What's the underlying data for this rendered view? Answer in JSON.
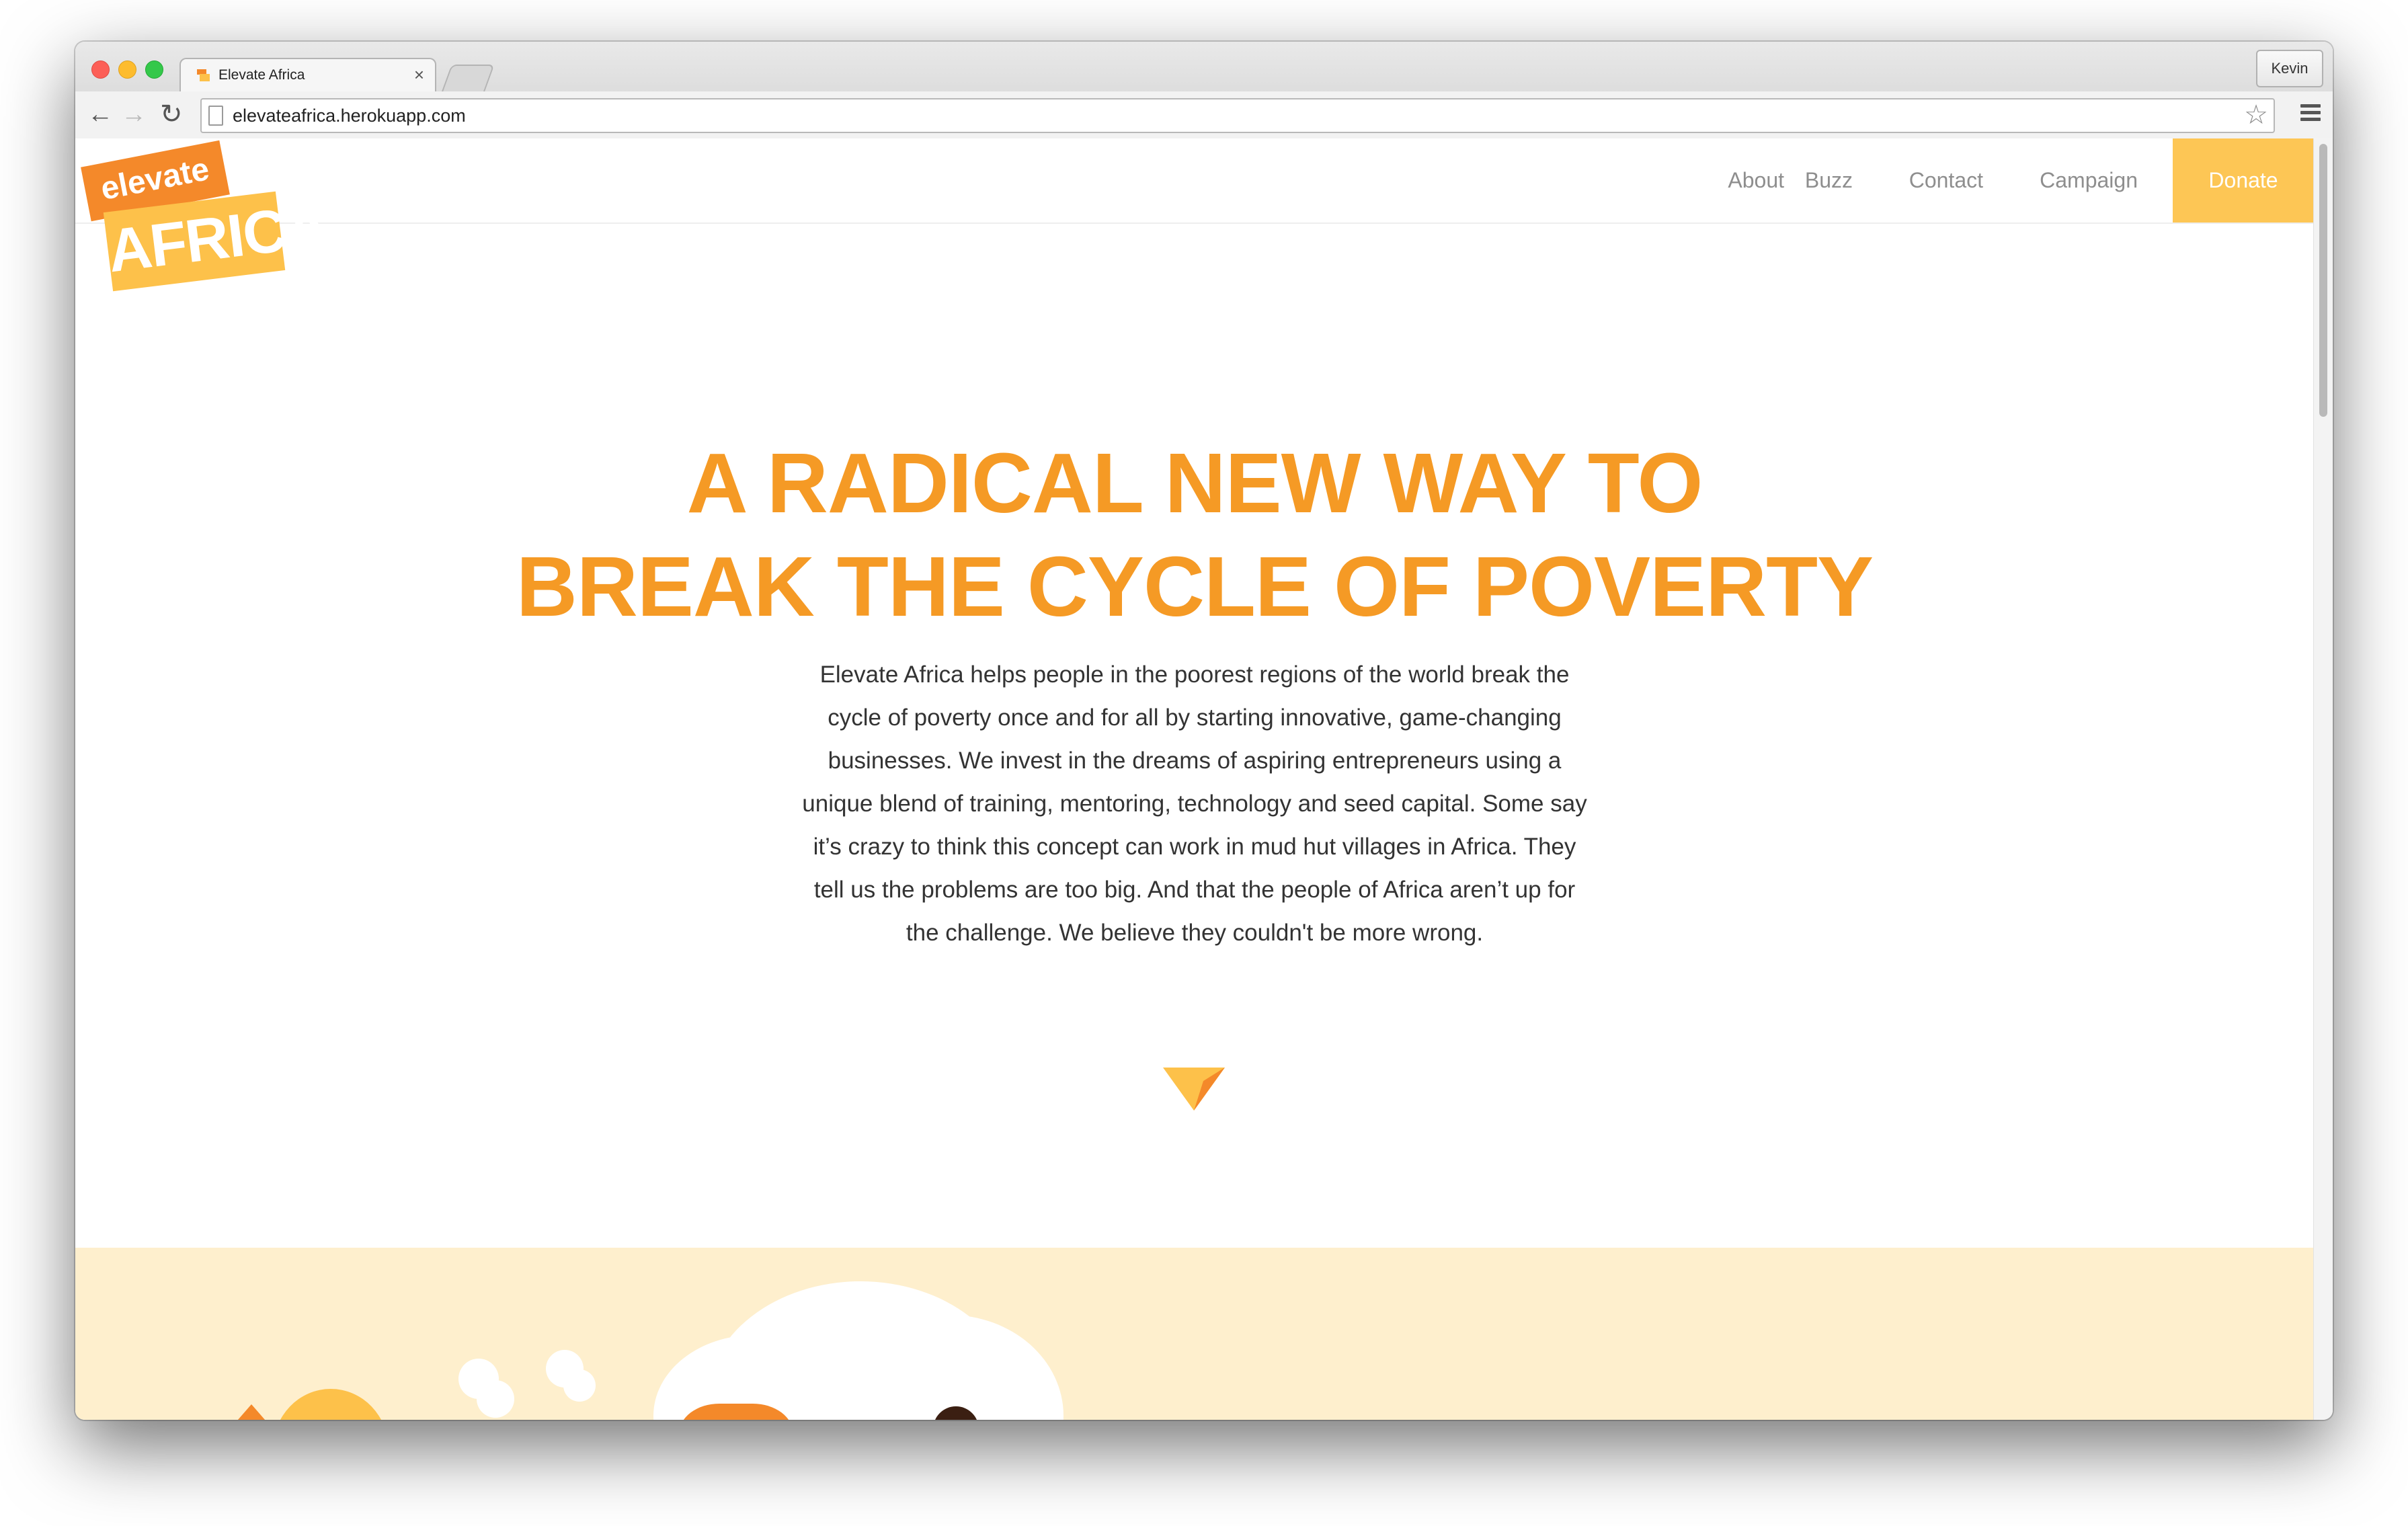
{
  "browser": {
    "tab_title": "Elevate Africa",
    "tab_close": "×",
    "profile_name": "Kevin",
    "url": "elevateafrica.herokuapp.com",
    "back_icon": "←",
    "forward_icon": "→",
    "reload_icon": "↻",
    "star_icon": "☆"
  },
  "site": {
    "logo": {
      "top": "elevate",
      "bottom": "AFRICA"
    },
    "nav": {
      "about": "About",
      "buzz": "Buzz",
      "contact": "Contact",
      "campaign": "Campaign",
      "donate": "Donate"
    },
    "hero": {
      "title_line1": "A RADICAL NEW WAY TO",
      "title_line2": "BREAK THE CYCLE OF POVERTY",
      "lines": [
        "Elevate Africa helps people in the poorest regions of the world break the",
        "cycle of poverty once and for all by starting innovative, game-changing",
        "businesses. We invest in the dreams of aspiring entrepreneurs using a",
        "unique blend of training, mentoring, technology and seed capital. Some say",
        "it’s crazy to think this concept can work in mud hut villages in Africa. They",
        "tell us the problems are too big. And that the people of Africa aren’t up for",
        "the challenge. We believe they couldn't be more wrong."
      ]
    }
  },
  "colors": {
    "brand_orange": "#f59a25",
    "logo_orange": "#f4892a",
    "donate_yellow": "#fdc655",
    "illustration_bg": "#feefcd"
  },
  "icons": [
    "back-arrow-icon",
    "forward-arrow-icon",
    "reload-icon",
    "page-icon",
    "star-icon",
    "menu-icon",
    "scroll-down-arrow-icon"
  ]
}
